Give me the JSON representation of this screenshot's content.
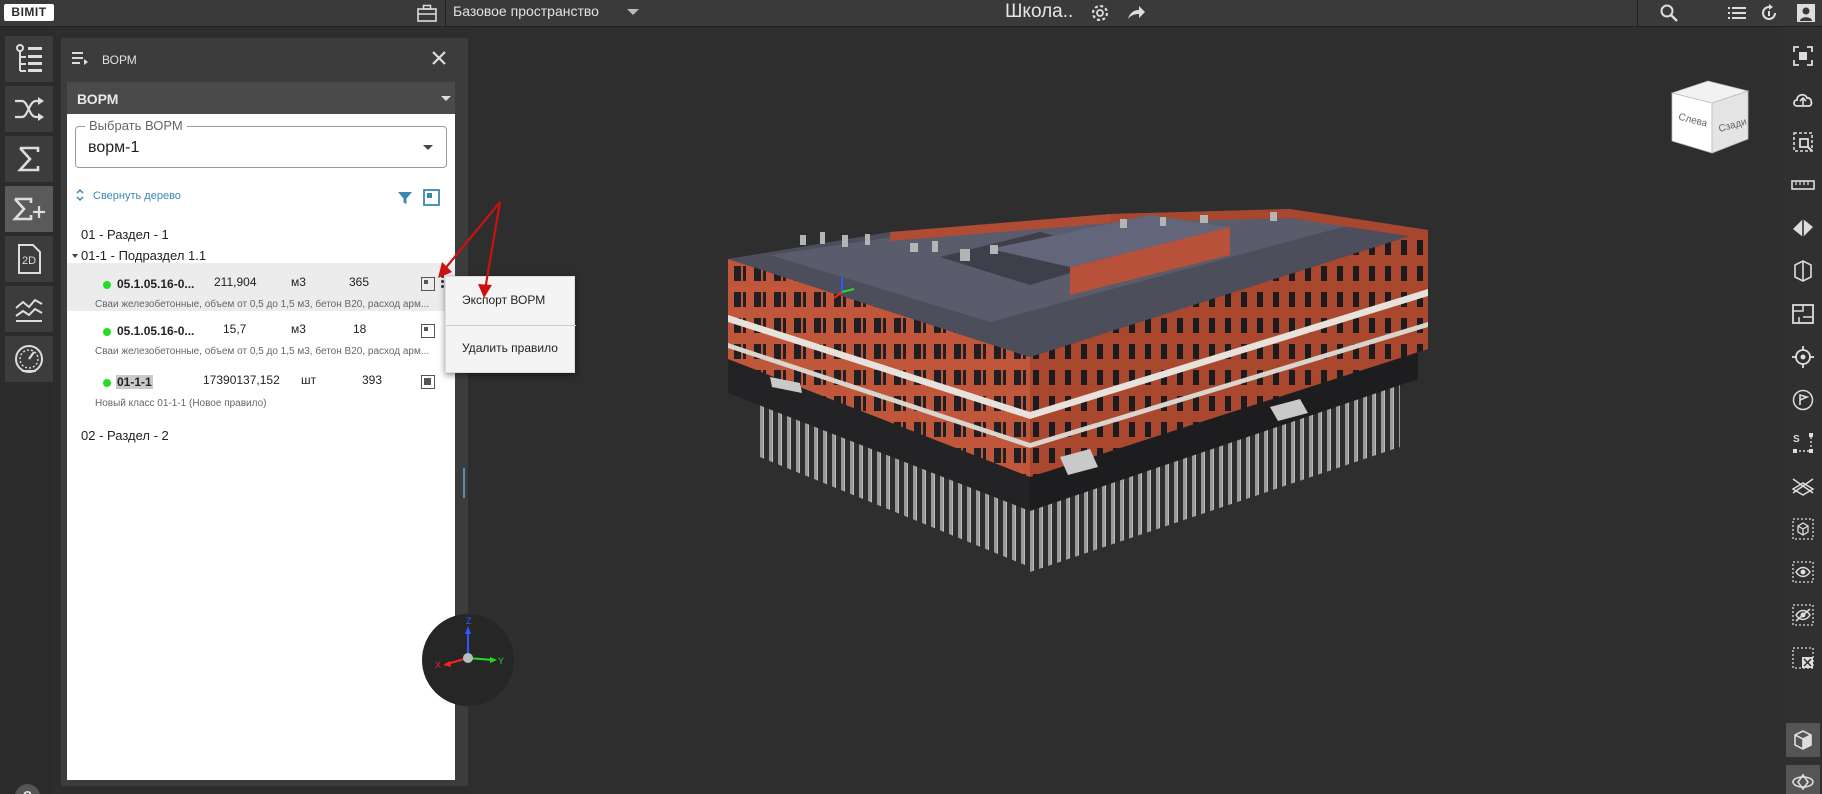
{
  "app": {
    "logo": "BIMIT"
  },
  "topbar": {
    "space": "Базовое пространство",
    "project_title": "Школа.."
  },
  "panel": {
    "title": "ВОРМ",
    "section_title": "ВОРМ",
    "select_label": "Выбрать ВОРМ",
    "select_value": "ворм-1",
    "collapse_label": "Свернуть дерево",
    "tree": {
      "section1": "01 - Раздел - 1",
      "subsection": "01-1 - Подраздел 1.1",
      "rows": [
        {
          "code": "05.1.05.16-0...",
          "qty": "211,904",
          "unit": "м3",
          "count": "365",
          "desc": "Сваи железобетонные, объем от 0,5 до 1,5 м3, бетон В20, расход арм..."
        },
        {
          "code": "05.1.05.16-0...",
          "qty": "15,7",
          "unit": "м3",
          "count": "18",
          "desc": "Сваи железобетонные, объем от 0,5 до 1,5 м3, бетон В20, расход арм..."
        },
        {
          "code": "01-1-1",
          "qty": "17390137,152",
          "unit": "шт",
          "count": "393",
          "desc": "Новый класс 01-1-1 (Новое правило)"
        }
      ],
      "section2": "02 - Раздел - 2"
    }
  },
  "context_menu": {
    "export_label": "Экспорт ВОРМ",
    "delete_label": "Удалить правило"
  },
  "viewcube": {
    "front_label": "Слева",
    "right_label": "Сзади"
  },
  "axes": {
    "x": "X",
    "y": "Y",
    "z": "Z"
  },
  "colors": {
    "accent": "#3a87b5",
    "status_dot": "#22dd22",
    "annotation": "#cc1111",
    "brick": "#c0563a"
  }
}
